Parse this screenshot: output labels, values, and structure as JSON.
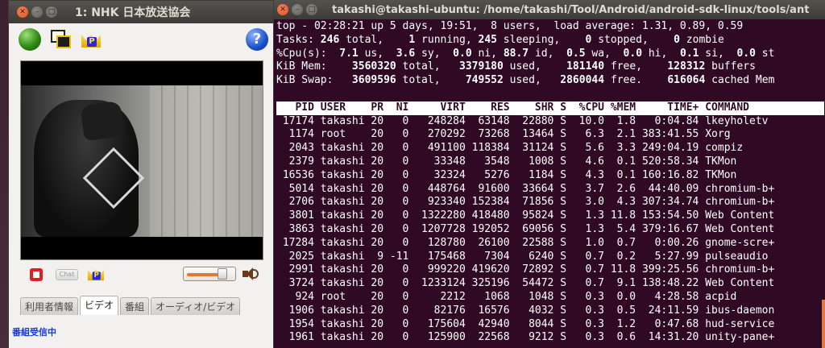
{
  "tv_window": {
    "title": "1: NHK 日本放送協会",
    "toolbar": {
      "help_label": "?"
    },
    "crown_label": "P",
    "chat_label": "Chat",
    "volume": 0.82,
    "tabs": [
      "利用者情報",
      "ビデオ",
      "番組",
      "オーディオ/ビデオ"
    ],
    "active_tab": 1,
    "status": "番組受信中"
  },
  "terminal": {
    "title": "takashi@takashi-ubuntu: /home/takashi/Tool/Android/android-sdk-linux/tools/ant",
    "summary": {
      "line1": "top - 02:28:21 up 5 days, 19:51,  8 users,  load average: 1.31, 0.89, 0.59",
      "tasks": {
        "label": "Tasks:",
        "total": "246",
        "running": "1",
        "sleeping": "245",
        "stopped": "0",
        "zombie": "0"
      },
      "cpu": {
        "label": "%Cpu(s):",
        "us": "7.1",
        "sy": "3.6",
        "ni": "0.0",
        "id": "88.7",
        "wa": "0.5",
        "hi": "0.0",
        "si": "0.1",
        "st": "0.0"
      },
      "mem": {
        "label": "KiB Mem:",
        "total": "3560320",
        "used": "3379180",
        "free": "181140",
        "buffers": "128312"
      },
      "swap": {
        "label": "KiB Swap:",
        "total": "3609596",
        "used": "749552",
        "free": "2860044",
        "cached": "616064"
      }
    },
    "columns": [
      "PID",
      "USER",
      "PR",
      "NI",
      "VIRT",
      "RES",
      "SHR",
      "S",
      "%CPU",
      "%MEM",
      "TIME+",
      "COMMAND"
    ],
    "processes": [
      [
        "17174",
        "takashi",
        "20",
        "0",
        "248284",
        "63148",
        "22880",
        "S",
        "10.0",
        "1.8",
        "0:04.84",
        "lkeyholetv"
      ],
      [
        "1174",
        "root",
        "20",
        "0",
        "270292",
        "73268",
        "13464",
        "S",
        "6.3",
        "2.1",
        "383:41.55",
        "Xorg"
      ],
      [
        "2043",
        "takashi",
        "20",
        "0",
        "491100",
        "118384",
        "31124",
        "S",
        "5.6",
        "3.3",
        "249:04.19",
        "compiz"
      ],
      [
        "2379",
        "takashi",
        "20",
        "0",
        "33348",
        "3548",
        "1008",
        "S",
        "4.6",
        "0.1",
        "520:58.34",
        "TKMon"
      ],
      [
        "16536",
        "takashi",
        "20",
        "0",
        "32324",
        "5276",
        "1184",
        "S",
        "4.3",
        "0.1",
        "160:16.82",
        "TKMon"
      ],
      [
        "5014",
        "takashi",
        "20",
        "0",
        "448764",
        "91600",
        "33664",
        "S",
        "3.7",
        "2.6",
        "44:40.09",
        "chromium-b+"
      ],
      [
        "2706",
        "takashi",
        "20",
        "0",
        "923340",
        "152384",
        "71856",
        "S",
        "3.0",
        "4.3",
        "307:34.74",
        "chromium-b+"
      ],
      [
        "3801",
        "takashi",
        "20",
        "0",
        "1322280",
        "418480",
        "95824",
        "S",
        "1.3",
        "11.8",
        "153:54.50",
        "Web Content"
      ],
      [
        "3863",
        "takashi",
        "20",
        "0",
        "1207728",
        "192052",
        "69056",
        "S",
        "1.3",
        "5.4",
        "379:16.67",
        "Web Content"
      ],
      [
        "17284",
        "takashi",
        "20",
        "0",
        "128780",
        "26100",
        "22588",
        "S",
        "1.0",
        "0.7",
        "0:00.26",
        "gnome-scre+"
      ],
      [
        "2025",
        "takashi",
        "9",
        "-11",
        "175468",
        "7304",
        "6240",
        "S",
        "0.7",
        "0.2",
        "5:27.99",
        "pulseaudio"
      ],
      [
        "2991",
        "takashi",
        "20",
        "0",
        "999220",
        "419620",
        "72892",
        "S",
        "0.7",
        "11.8",
        "399:25.56",
        "chromium-b+"
      ],
      [
        "3724",
        "takashi",
        "20",
        "0",
        "1233124",
        "325196",
        "54472",
        "S",
        "0.7",
        "9.1",
        "138:48.22",
        "Web Content"
      ],
      [
        "924",
        "root",
        "20",
        "0",
        "2212",
        "1068",
        "1048",
        "S",
        "0.3",
        "0.0",
        "4:28.58",
        "acpid"
      ],
      [
        "1906",
        "takashi",
        "20",
        "0",
        "82176",
        "16576",
        "4032",
        "S",
        "0.3",
        "0.5",
        "24:11.59",
        "ibus-daemon"
      ],
      [
        "1954",
        "takashi",
        "20",
        "0",
        "175604",
        "42940",
        "8044",
        "S",
        "0.3",
        "1.2",
        "0:47.68",
        "hud-service"
      ],
      [
        "1961",
        "takashi",
        "20",
        "0",
        "125900",
        "22568",
        "9212",
        "S",
        "0.3",
        "0.6",
        "14:31.20",
        "unity-pane+"
      ]
    ]
  }
}
